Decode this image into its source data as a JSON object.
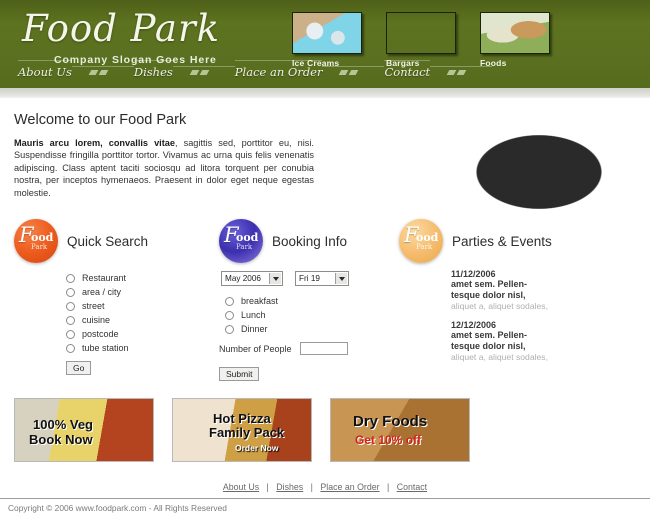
{
  "header": {
    "brand_name": "Food Park",
    "slogan": "Company Slogan Goes Here",
    "thumbs": [
      {
        "label": "Ice Creams",
        "icon": "ice-cream-thumb"
      },
      {
        "label": "Bargars",
        "icon": "burger-thumb"
      },
      {
        "label": "Foods",
        "icon": "foods-thumb"
      }
    ],
    "nav": [
      {
        "label": "About Us"
      },
      {
        "label": "Dishes"
      },
      {
        "label": "Place an Order"
      },
      {
        "label": "Contact"
      }
    ]
  },
  "welcome": {
    "title": "Welcome to our Food Park",
    "lead": "Mauris arcu lorem, convallis vitae",
    "body": ", sagittis sed, porttitor eu, nisi. Suspendisse fringilla porttitor tortor. Vivamus ac urna quis felis venenatis adipiscing. Class aptent taciti sociosqu ad litora torquent per conubia nostra, per inceptos hymenaeos. Praesent in dolor eget neque egestas molestie.",
    "hero_icon": "bread-platter-image"
  },
  "quick_search": {
    "title": "Quick Search",
    "logo_word_f": "F",
    "logo_word_ood": "ood",
    "logo_word_park": "Park",
    "logo_color": "#ef5f21",
    "options": [
      {
        "label": "Restaurant"
      },
      {
        "label": "area / city"
      },
      {
        "label": "street"
      },
      {
        "label": "cuisine"
      },
      {
        "label": "postcode"
      },
      {
        "label": "tube station"
      }
    ],
    "go_label": "Go"
  },
  "booking": {
    "title": "Booking Info",
    "logo_word_f": "F",
    "logo_word_ood": "ood",
    "logo_word_park": "Park",
    "logo_color": "#3b2fae",
    "month_value": "May 2006",
    "day_value": "Fri 19",
    "meals": [
      {
        "label": "breakfast"
      },
      {
        "label": "Lunch"
      },
      {
        "label": "Dinner"
      }
    ],
    "people_label": "Number of People",
    "people_value": "",
    "submit_label": "Submit"
  },
  "parties": {
    "title": "Parties & Events",
    "logo_word_f": "F",
    "logo_word_ood": "ood",
    "logo_word_park": "Park",
    "logo_color": "#f6bd70",
    "events": [
      {
        "date": "11/12/2006",
        "title": "amet sem. Pellen-tesque dolor nisl,",
        "sub": "aliquet a, aliquet sodales,"
      },
      {
        "date": "12/12/2006",
        "title": "amet sem. Pellen-tesque dolor nisl,",
        "sub": "aliquet a, aliquet sodales,"
      }
    ]
  },
  "banners": [
    {
      "line1": "100% Veg",
      "line2": "Book Now",
      "line3": ""
    },
    {
      "line1": "Hot Pizza",
      "line2": "Family Pack",
      "line3": "Order Now"
    },
    {
      "line1": "Dry Foods",
      "line2": "Get 10% off",
      "line3": ""
    }
  ],
  "footer": {
    "links": [
      {
        "label": "About Us"
      },
      {
        "label": "Dishes"
      },
      {
        "label": "Place an Order"
      },
      {
        "label": "Contact"
      }
    ],
    "separator": "|",
    "copyright": "Copyright © 2006 www.foodpark.com - All Rights Reserved"
  }
}
